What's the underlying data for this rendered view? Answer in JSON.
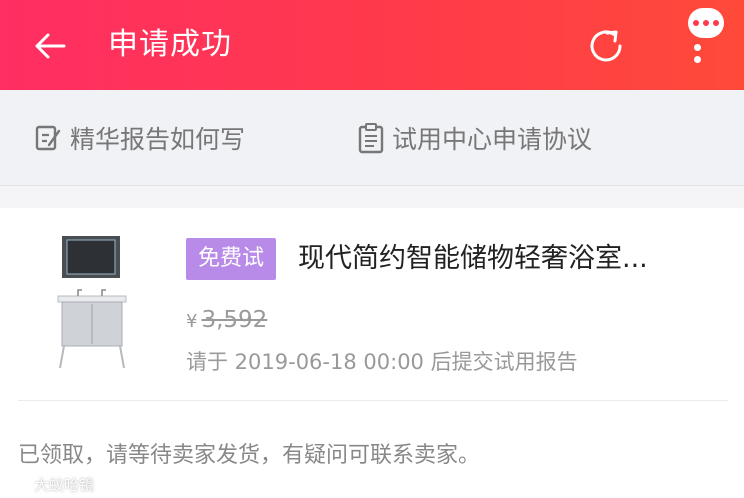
{
  "header": {
    "title": "申请成功",
    "back_icon": "arrow-left-icon",
    "refresh_icon": "refresh-icon",
    "more_icon": "more-dots-icon",
    "background": "#ff3a4a"
  },
  "links": [
    {
      "label": "精华报告如何写",
      "icon": "edit-document-icon"
    },
    {
      "label": "试用中心申请协议",
      "icon": "clipboard-icon"
    }
  ],
  "product": {
    "badge": "免费试",
    "badge_color": "#b98be9",
    "title": "现代简约智能储物轻奢浴室...",
    "currency": "¥",
    "price": "3,592",
    "deadline": "请于 2019-06-18 00:00 后提交试用报告",
    "image_icon": "bathroom-cabinet-image"
  },
  "status_text": "已领取，请等待卖家发货，有疑问可联系卖家。",
  "watermark": {
    "text": "大蚊哈镜"
  }
}
